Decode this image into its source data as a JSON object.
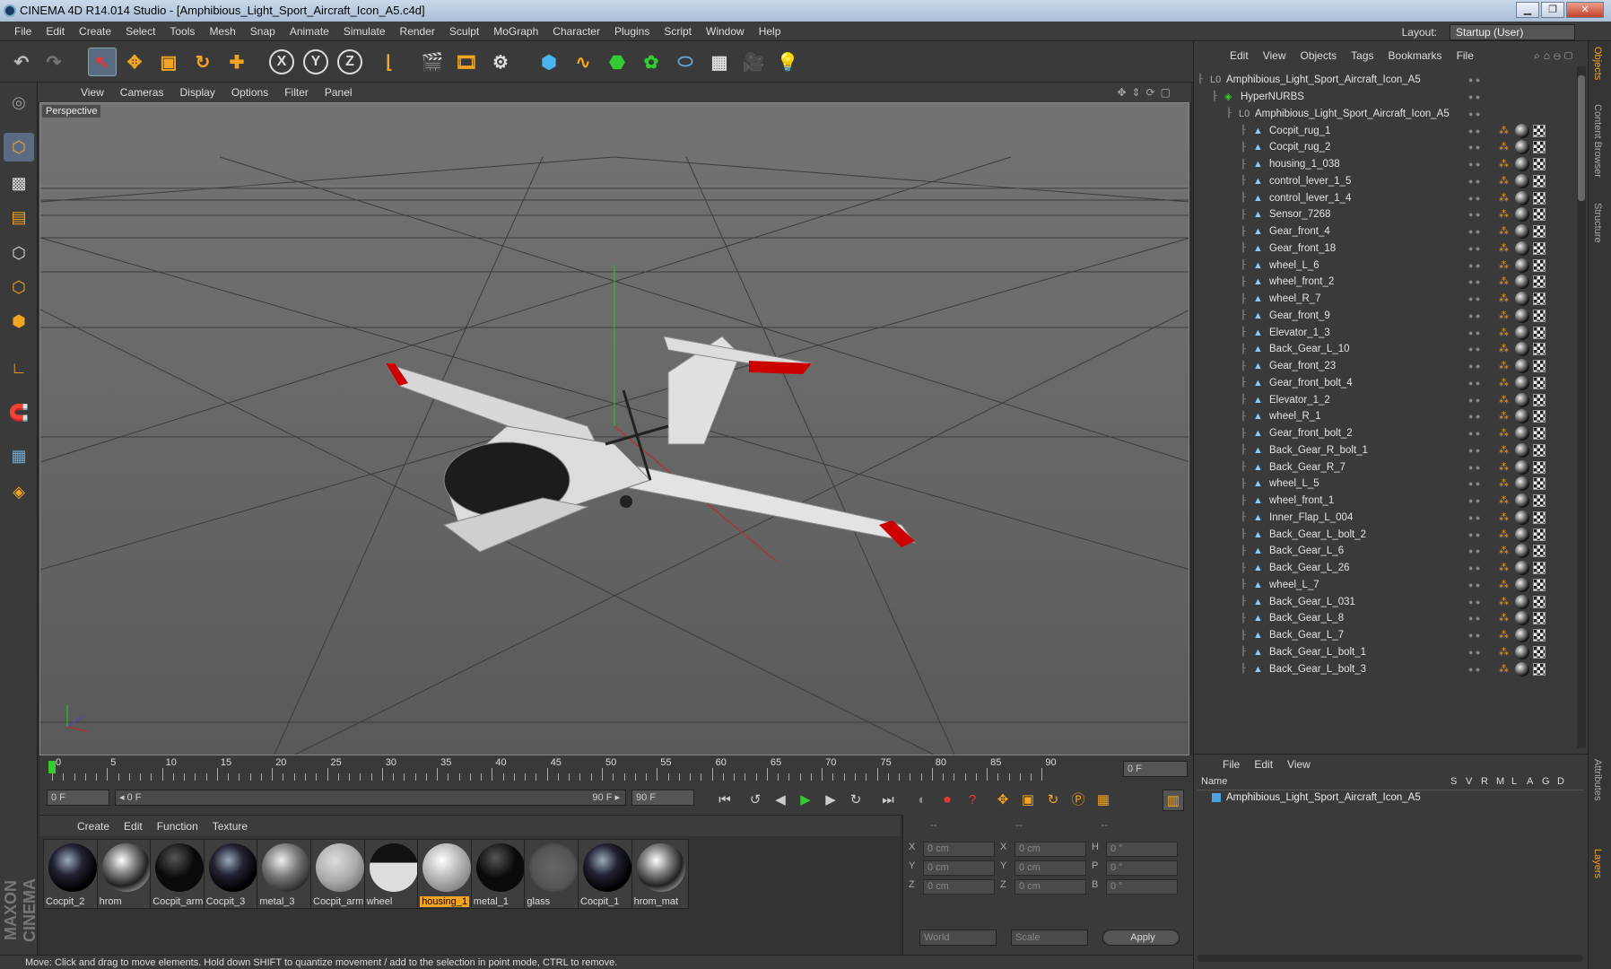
{
  "window": {
    "title": "CINEMA 4D R14.014 Studio - [Amphibious_Light_Sport_Aircraft_Icon_A5.c4d]",
    "minimize": "▁",
    "maximize": "❐",
    "close": "✕"
  },
  "menubar": {
    "items": [
      "File",
      "Edit",
      "Create",
      "Select",
      "Tools",
      "Mesh",
      "Snap",
      "Animate",
      "Simulate",
      "Render",
      "Sculpt",
      "MoGraph",
      "Character",
      "Plugins",
      "Script",
      "Window",
      "Help"
    ],
    "layout_label": "Layout:",
    "layout_value": "Startup (User)"
  },
  "viewport": {
    "menu": [
      "View",
      "Cameras",
      "Display",
      "Options",
      "Filter",
      "Panel"
    ],
    "label": "Perspective"
  },
  "timeline": {
    "ticks": [
      "0",
      "5",
      "10",
      "15",
      "20",
      "25",
      "30",
      "35",
      "40",
      "45",
      "50",
      "55",
      "60",
      "65",
      "70",
      "75",
      "80",
      "85",
      "90"
    ],
    "frame_end_field": "0 F"
  },
  "playback": {
    "current": "0 F",
    "range_start": "◂ 0 F",
    "range_end": "90 F ▸",
    "end": "90 F"
  },
  "materials": {
    "menu": [
      "Create",
      "Edit",
      "Function",
      "Texture"
    ],
    "items": [
      {
        "label": "Cocpit_2",
        "style": "dark"
      },
      {
        "label": "hrom",
        "style": "chrome"
      },
      {
        "label": "Cocpit_arm",
        "style": "black"
      },
      {
        "label": "Cocpit_3",
        "style": "dark"
      },
      {
        "label": "metal_3",
        "style": "metal"
      },
      {
        "label": "Cocpit_arm",
        "style": "grey"
      },
      {
        "label": "wheel",
        "style": "wheel"
      },
      {
        "label": "housing_1",
        "style": "housing",
        "selected": true
      },
      {
        "label": "metal_1",
        "style": "black"
      },
      {
        "label": "glass",
        "style": "glass"
      },
      {
        "label": "Cocpit_1",
        "style": "dark"
      },
      {
        "label": "hrom_mat",
        "style": "chrome"
      }
    ]
  },
  "coords": {
    "headers": [
      "--",
      "--",
      "--"
    ],
    "rows": [
      {
        "a": "X",
        "av": "0 cm",
        "b": "X",
        "bv": "0 cm",
        "c": "H",
        "cv": "0 °"
      },
      {
        "a": "Y",
        "av": "0 cm",
        "b": "Y",
        "bv": "0 cm",
        "c": "P",
        "cv": "0 °"
      },
      {
        "a": "Z",
        "av": "0 cm",
        "b": "Z",
        "bv": "0 cm",
        "c": "B",
        "cv": "0 °"
      }
    ],
    "world": "World",
    "scale": "Scale",
    "apply": "Apply"
  },
  "status": "Move: Click and drag to move elements. Hold down SHIFT to quantize movement / add to the selection in point mode, CTRL to remove.",
  "objects": {
    "menu": [
      "File",
      "Edit",
      "View",
      "Objects",
      "Tags",
      "Bookmarks"
    ],
    "root": "Amphibious_Light_Sport_Aircraft_Icon_A5",
    "hypernurbs": "HyperNURBS",
    "group": "Amphibious_Light_Sport_Aircraft_Icon_A5",
    "children": [
      "Cocpit_rug_1",
      "Cocpit_rug_2",
      "housing_1_038",
      "control_lever_1_5",
      "control_lever_1_4",
      "Sensor_7268",
      "Gear_front_4",
      "Gear_front_18",
      "wheel_L_6",
      "wheel_front_2",
      "wheel_R_7",
      "Gear_front_9",
      "Elevator_1_3",
      "Back_Gear_L_10",
      "Gear_front_23",
      "Gear_front_bolt_4",
      "Elevator_1_2",
      "wheel_R_1",
      "Gear_front_bolt_2",
      "Back_Gear_R_bolt_1",
      "Back_Gear_R_7",
      "wheel_L_5",
      "wheel_front_1",
      "Inner_Flap_L_004",
      "Back_Gear_L_bolt_2",
      "Back_Gear_L_6",
      "Back_Gear_L_26",
      "wheel_L_7",
      "Back_Gear_L_031",
      "Back_Gear_L_8",
      "Back_Gear_L_7",
      "Back_Gear_L_bolt_1",
      "Back_Gear_L_bolt_3"
    ]
  },
  "layers": {
    "menu": [
      "File",
      "Edit",
      "View"
    ],
    "columns": [
      "Name",
      "S",
      "V",
      "R",
      "M",
      "L",
      "A",
      "G",
      "D"
    ],
    "row": "Amphibious_Light_Sport_Aircraft_Icon_A5"
  },
  "sidetabs": [
    "Objects",
    "Content Browser",
    "Structure",
    "Attributes",
    "Layers"
  ],
  "maxon": "MAXON CINEMA 4D"
}
